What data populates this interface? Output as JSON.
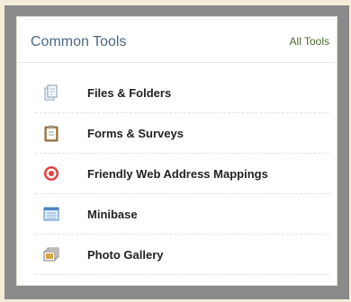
{
  "panel": {
    "title": "Common Tools",
    "all_tools_link": "All Tools"
  },
  "tools": [
    {
      "label": "Files & Folders",
      "icon": "files-folders-icon"
    },
    {
      "label": "Forms & Surveys",
      "icon": "clipboard-icon"
    },
    {
      "label": "Friendly Web Address Mappings",
      "icon": "target-icon"
    },
    {
      "label": "Minibase",
      "icon": "database-window-icon"
    },
    {
      "label": "Photo Gallery",
      "icon": "photo-stack-icon"
    }
  ]
}
